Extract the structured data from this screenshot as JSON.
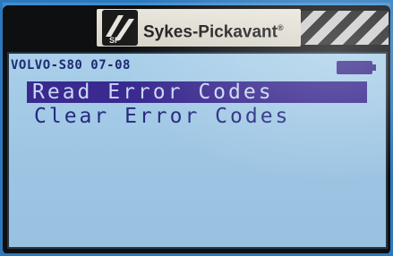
{
  "brand": {
    "name": "Sykes-Pickavant",
    "trademark": "®",
    "logo_letters": "SP"
  },
  "screen": {
    "status": "VOLVO-S80 07-08",
    "battery_icon": "battery-icon",
    "menu": [
      {
        "label": "Read Error Codes",
        "selected": true
      },
      {
        "label": "Clear Error Codes",
        "selected": false
      }
    ]
  },
  "colors": {
    "lcd": "#a9cfe9",
    "text": "#252a7e",
    "highlight": "#3a2a8f",
    "frame": "#2d78bd"
  }
}
